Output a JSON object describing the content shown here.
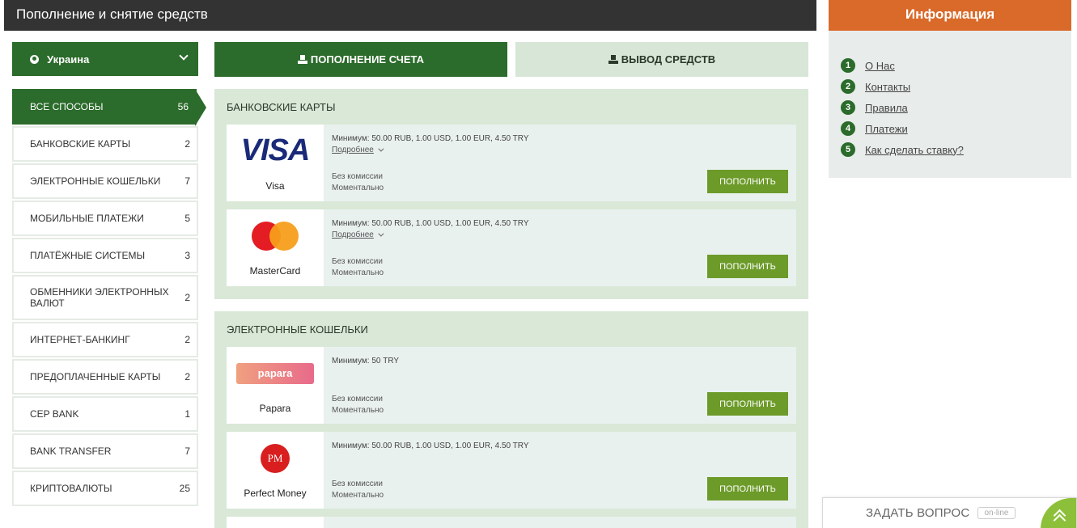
{
  "header": {
    "title": "Пополнение и снятие средств"
  },
  "country": {
    "label": "Украина",
    "icon": "globe-icon"
  },
  "tabs": {
    "deposit": "ПОПОЛНЕНИЕ СЧЕТА",
    "withdraw": "ВЫВОД СРЕДСТВ"
  },
  "categories": [
    {
      "label": "ВСЕ СПОСОБЫ",
      "count": "56"
    },
    {
      "label": "БАНКОВСКИЕ КАРТЫ",
      "count": "2"
    },
    {
      "label": "ЭЛЕКТРОННЫЕ КОШЕЛЬКИ",
      "count": "7"
    },
    {
      "label": "МОБИЛЬНЫЕ ПЛАТЕЖИ",
      "count": "5"
    },
    {
      "label": "ПЛАТЁЖНЫЕ СИСТЕМЫ",
      "count": "3"
    },
    {
      "label": "ОБМЕННИКИ ЭЛЕКТРОННЫХ ВАЛЮТ",
      "count": "2"
    },
    {
      "label": "ИНТЕРНЕТ-БАНКИНГ",
      "count": "2"
    },
    {
      "label": "ПРЕДОПЛАЧЕННЫЕ КАРТЫ",
      "count": "2"
    },
    {
      "label": "CEP BANK",
      "count": "1"
    },
    {
      "label": "BANK TRANSFER",
      "count": "7"
    },
    {
      "label": "КРИПТОВАЛЮТЫ",
      "count": "25"
    }
  ],
  "sections": {
    "cards": {
      "title": "БАНКОВСКИЕ КАРТЫ",
      "items": [
        {
          "name": "Visa",
          "logo_text": "VISA",
          "min": "Минимум: 50.00 RUB, 1.00 USD, 1.00 EUR, 4.50 TRY",
          "more": "Подробнее",
          "fee": "Без комиссии",
          "speed": "Моментально",
          "button": "ПОПОЛНИТЬ"
        },
        {
          "name": "MasterCard",
          "min": "Минимум: 50.00 RUB, 1.00 USD, 1.00 EUR, 4.50 TRY",
          "more": "Подробнее",
          "fee": "Без комиссии",
          "speed": "Моментально",
          "button": "ПОПОЛНИТЬ"
        }
      ]
    },
    "wallets": {
      "title": "ЭЛЕКТРОННЫЕ КОШЕЛЬКИ",
      "items": [
        {
          "name": "Papara",
          "logo_text": "papara",
          "min": "Минимум: 50 TRY",
          "fee": "Без комиссии",
          "speed": "Моментально",
          "button": "ПОПОЛНИТЬ"
        },
        {
          "name": "Perfect Money",
          "logo_text": "PM",
          "min": "Минимум: 50.00 RUB, 1.00 USD, 1.00 EUR, 4.50 TRY",
          "fee": "Без комиссии",
          "speed": "Моментально",
          "button": "ПОПОЛНИТЬ"
        }
      ]
    }
  },
  "info": {
    "title": "Информация",
    "links": [
      {
        "num": "1",
        "label": "О Нас"
      },
      {
        "num": "2",
        "label": "Контакты"
      },
      {
        "num": "3",
        "label": "Правила"
      },
      {
        "num": "4",
        "label": "Платежи"
      },
      {
        "num": "5",
        "label": "Как сделать ставку?"
      }
    ]
  },
  "chat": {
    "label": "ЗАДАТЬ ВОПРОС",
    "status": "on-line"
  },
  "colors": {
    "primary_green": "#2b6b2b",
    "button_green": "#6d9b2a",
    "info_orange": "#d96a2a",
    "header_dark": "#333333",
    "section_bg": "#d9e8d7"
  }
}
